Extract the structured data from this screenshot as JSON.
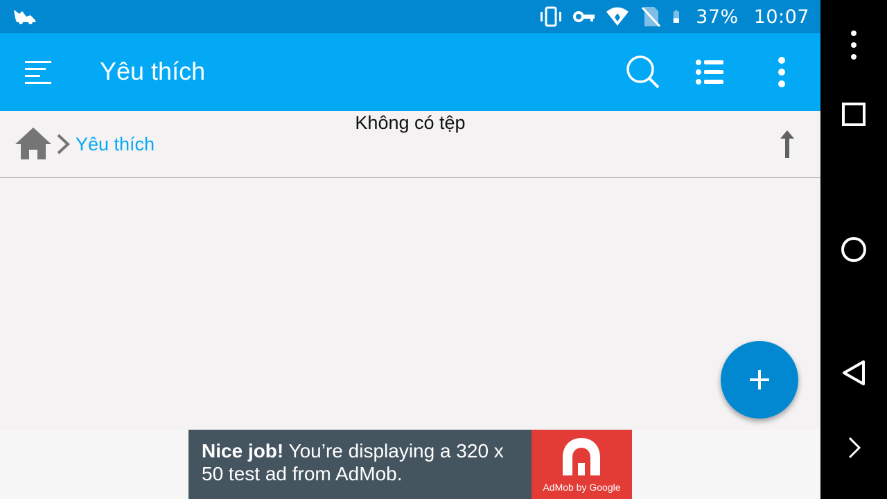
{
  "status_bar": {
    "battery": "37%",
    "time": "10:07",
    "icons": [
      "app-notification-icon",
      "vibrate-icon",
      "vpn-key-icon",
      "wifi-icon",
      "no-sim-icon",
      "battery-icon"
    ]
  },
  "toolbar": {
    "title": "Yêu thích",
    "icons": [
      "menu-icon",
      "search-icon",
      "list-view-icon",
      "more-vert-icon"
    ]
  },
  "breadcrumb": {
    "home_icon": "home-icon",
    "separator_icon": "chevron-right-icon",
    "current": "Yêu thích",
    "up_icon": "arrow-up-icon"
  },
  "content": {
    "empty_message": "Không có tệp"
  },
  "fab": {
    "icon": "plus-icon"
  },
  "ad": {
    "headline": "Nice job!",
    "body": " You’re displaying a 320 x 50 test ad from AdMob.",
    "brand": "AdMob by Google"
  },
  "nav_bar": {
    "icons": [
      "more-vert-icon",
      "recents-square-icon",
      "home-circle-icon",
      "back-triangle-icon",
      "chevron-right-icon"
    ]
  },
  "colors": {
    "status_bar": "#0288d1",
    "toolbar": "#03a9f4",
    "accent": "#03a9f4",
    "fab": "#0288d1",
    "background": "#f4f2f3",
    "ad_bg": "#44555f",
    "ad_logo": "#e33b36"
  }
}
